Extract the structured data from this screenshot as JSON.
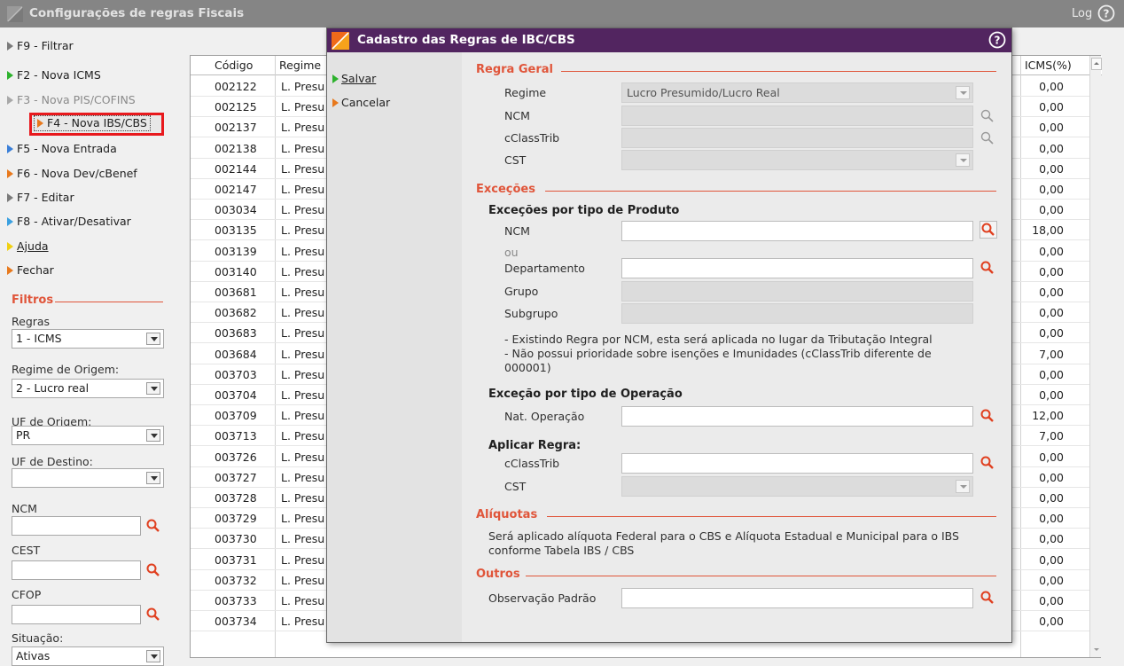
{
  "window": {
    "title": "Configurações de regras Fiscais",
    "log_label": "Log"
  },
  "menu": [
    {
      "label": "F9 - Filtrar",
      "color": "#7a7a7a",
      "disabled": false
    },
    {
      "label": "F2 - Nova ICMS",
      "color": "#2db22d",
      "disabled": false
    },
    {
      "label": "F3 - Nova PIS/COFINS",
      "color": "#9a9a9a",
      "disabled": true
    },
    {
      "label": "F4 - Nova IBS/CBS",
      "color": "#e8791d",
      "disabled": false
    },
    {
      "label": "F5 - Nova Entrada",
      "color": "#3a7fd8",
      "disabled": false
    },
    {
      "label": "F6 - Nova Dev/cBenef",
      "color": "#e8791d",
      "disabled": false
    },
    {
      "label": "F7 - Editar",
      "color": "#7a7a7a",
      "disabled": false
    },
    {
      "label": "F8 - Ativar/Desativar",
      "color": "#3aa0e0",
      "disabled": false
    },
    {
      "label": "Ajuda",
      "color": "#f0d010",
      "disabled": false
    },
    {
      "label": "Fechar",
      "color": "#e8791d",
      "disabled": false
    }
  ],
  "filters": {
    "title": "Filtros",
    "regras_label": "Regras",
    "regras_value": "1 - ICMS",
    "regime_label": "Regime de Origem:",
    "regime_value": "2 - Lucro real",
    "uf_origem_label": "UF de Origem:",
    "uf_origem_value": "PR",
    "uf_destino_label": "UF de Destino:",
    "uf_destino_value": "",
    "ncm_label": "NCM",
    "cest_label": "CEST",
    "cfop_label": "CFOP",
    "situacao_label": "Situação:",
    "situacao_value": "Ativas"
  },
  "grid": {
    "headers": {
      "codigo": "Código",
      "regime": "Regime",
      "icms": "ICMS(%)"
    },
    "rows": [
      {
        "codigo": "002122",
        "regime": "L. Presu",
        "icms": "0,00"
      },
      {
        "codigo": "002125",
        "regime": "L. Presu",
        "icms": "0,00"
      },
      {
        "codigo": "002137",
        "regime": "L. Presu",
        "icms": "0,00"
      },
      {
        "codigo": "002138",
        "regime": "L. Presu",
        "icms": "0,00"
      },
      {
        "codigo": "002144",
        "regime": "L. Presu",
        "icms": "0,00"
      },
      {
        "codigo": "002147",
        "regime": "L. Presu",
        "icms": "0,00"
      },
      {
        "codigo": "003034",
        "regime": "L. Presu",
        "icms": "0,00"
      },
      {
        "codigo": "003135",
        "regime": "L. Presu",
        "icms": "18,00"
      },
      {
        "codigo": "003139",
        "regime": "L. Presu",
        "icms": "0,00"
      },
      {
        "codigo": "003140",
        "regime": "L. Presu",
        "icms": "0,00"
      },
      {
        "codigo": "003681",
        "regime": "L. Presu",
        "icms": "0,00"
      },
      {
        "codigo": "003682",
        "regime": "L. Presu",
        "icms": "0,00"
      },
      {
        "codigo": "003683",
        "regime": "L. Presu",
        "icms": "0,00"
      },
      {
        "codigo": "003684",
        "regime": "L. Presu",
        "icms": "7,00"
      },
      {
        "codigo": "003703",
        "regime": "L. Presu",
        "icms": "0,00"
      },
      {
        "codigo": "003704",
        "regime": "L. Presu",
        "icms": "0,00"
      },
      {
        "codigo": "003709",
        "regime": "L. Presu",
        "icms": "12,00"
      },
      {
        "codigo": "003713",
        "regime": "L. Presu",
        "icms": "7,00"
      },
      {
        "codigo": "003726",
        "regime": "L. Presu",
        "icms": "0,00"
      },
      {
        "codigo": "003727",
        "regime": "L. Presu",
        "icms": "0,00"
      },
      {
        "codigo": "003728",
        "regime": "L. Presu",
        "icms": "0,00"
      },
      {
        "codigo": "003729",
        "regime": "L. Presu",
        "icms": "0,00"
      },
      {
        "codigo": "003730",
        "regime": "L. Presu",
        "icms": "0,00"
      },
      {
        "codigo": "003731",
        "regime": "L. Presu",
        "icms": "0,00"
      },
      {
        "codigo": "003732",
        "regime": "L. Presu",
        "icms": "0,00"
      },
      {
        "codigo": "003733",
        "regime": "L. Presu",
        "icms": "0,00"
      },
      {
        "codigo": "003734",
        "regime": "L. Presu",
        "icms": "0,00"
      }
    ]
  },
  "dialog": {
    "title": "Cadastro das Regras de IBC/CBS",
    "salvar": "Salvar",
    "cancelar": "Cancelar",
    "regra_geral": "Regra Geral",
    "regime_label": "Regime",
    "regime_value": "Lucro Presumido/Lucro Real",
    "ncm_label": "NCM",
    "cclasstrib_label": "cClassTrib",
    "cst_label": "CST",
    "excecoes": "Exceções",
    "exc_produto": "Exceções por tipo de Produto",
    "exc_ncm_label": "NCM",
    "ou_label": "ou",
    "departamento_label": "Departamento",
    "grupo_label": "Grupo",
    "subgrupo_label": "Subgrupo",
    "note1": "- Existindo Regra por NCM, esta será aplicada no lugar da Tributação Integral",
    "note2a": "- Não possui prioridade sobre isenções e Imunidades (cClassTrib diferente de",
    "note2b": "000001)",
    "exc_operacao": "Exceção por tipo de Operação",
    "nat_operacao_label": "Nat. Operação",
    "aplicar_regra": "Aplicar Regra:",
    "ap_cclasstrib_label": "cClassTrib",
    "ap_cst_label": "CST",
    "aliquotas": "Alíquotas",
    "aliquotas_text1": "Será aplicado alíquota Federal para o CBS e Alíquota Estadual e Municipal para o IBS",
    "aliquotas_text2": "conforme Tabela IBS / CBS",
    "outros": "Outros",
    "obs_label": "Observação Padrão"
  },
  "colors": {
    "accent": "#e0553a",
    "dialog_title": "#522560",
    "main_title": "#858585",
    "highlight_border": "#e8191d"
  }
}
